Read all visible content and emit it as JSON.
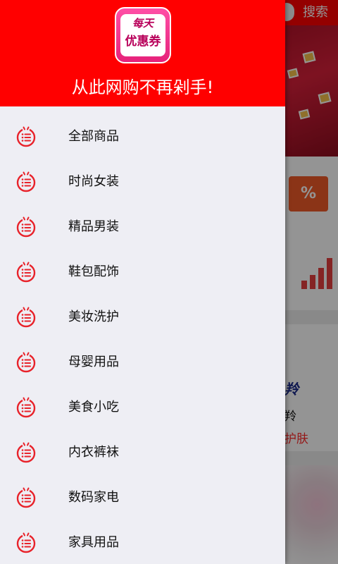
{
  "background": {
    "search_label": "搜索",
    "promo_badge": "%",
    "promo_text_1": "羚",
    "promo_text_2": "羚",
    "promo_text_3": "护肤"
  },
  "drawer": {
    "logo_line1": "每天",
    "logo_line2": "优惠券",
    "tagline": "从此网购不再剁手!",
    "items": [
      {
        "label": "全部商品",
        "icon": "list-icon"
      },
      {
        "label": "时尚女装",
        "icon": "list-icon"
      },
      {
        "label": "精品男装",
        "icon": "list-icon"
      },
      {
        "label": "鞋包配饰",
        "icon": "list-icon"
      },
      {
        "label": "美妆洗护",
        "icon": "list-icon"
      },
      {
        "label": "母婴用品",
        "icon": "list-icon"
      },
      {
        "label": "美食小吃",
        "icon": "list-icon"
      },
      {
        "label": "内衣裤袜",
        "icon": "list-icon"
      },
      {
        "label": "数码家电",
        "icon": "list-icon"
      },
      {
        "label": "家具用品",
        "icon": "list-icon"
      }
    ]
  },
  "colors": {
    "brand_red": "#ff0000",
    "drawer_bg": "#eeeef4",
    "icon_red": "#e8222a"
  }
}
